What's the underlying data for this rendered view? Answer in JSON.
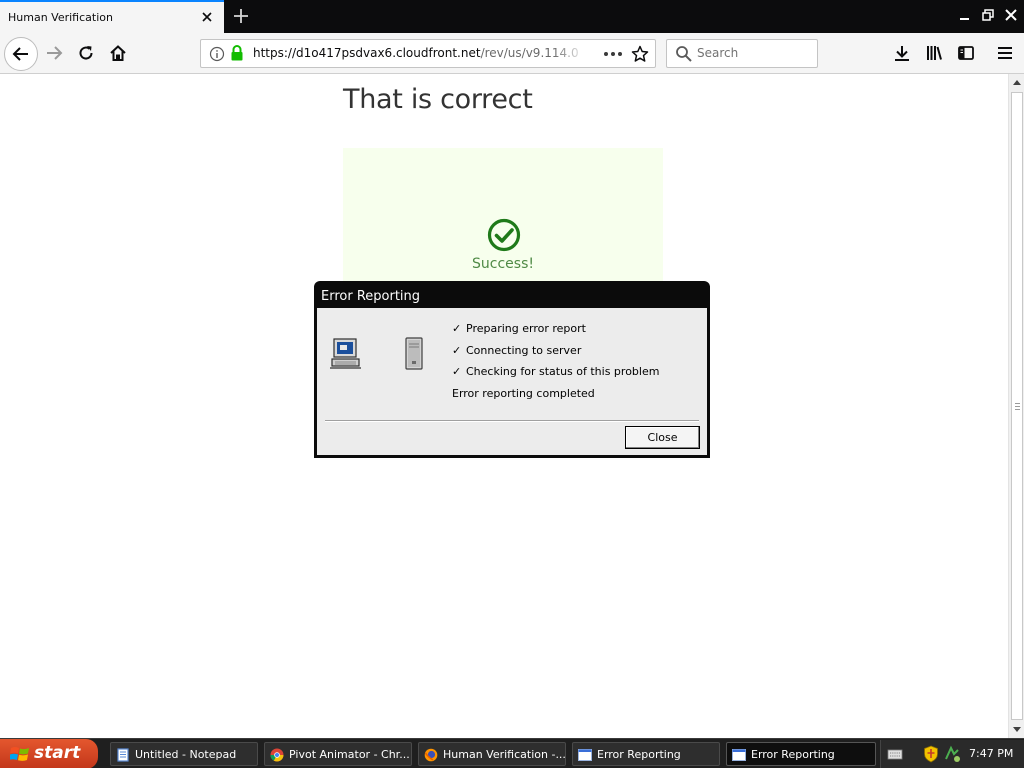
{
  "browser": {
    "tab": {
      "title": "Human Verification"
    },
    "url": {
      "host": "https://d1o417psdvax6.cloudfront.net",
      "path": "/rev/us/v9.114.0"
    },
    "search": {
      "placeholder": "Search"
    }
  },
  "page": {
    "heading": "That is correct",
    "success_label": "Success!",
    "colors": {
      "success_green": "#2e8b22",
      "panel_bg": "#f7ffed"
    }
  },
  "dialog": {
    "title": "Error Reporting",
    "steps": [
      {
        "check": "✓",
        "label": "Preparing error report"
      },
      {
        "check": "✓",
        "label": "Connecting to server"
      },
      {
        "check": "✓",
        "label": "Checking for status of this problem"
      }
    ],
    "status": "Error reporting completed",
    "close_label": "Close"
  },
  "taskbar": {
    "start_label": "start",
    "tasks": [
      {
        "label": "Untitled - Notepad",
        "icon": "notepad-icon"
      },
      {
        "label": "Pivot Animator - Chr...",
        "icon": "chrome-icon"
      },
      {
        "label": "Human Verification -...",
        "icon": "firefox-icon"
      },
      {
        "label": "Error Reporting",
        "icon": "window-icon"
      },
      {
        "label": "Error Reporting",
        "icon": "window-icon"
      }
    ],
    "clock": "7:47 PM"
  }
}
